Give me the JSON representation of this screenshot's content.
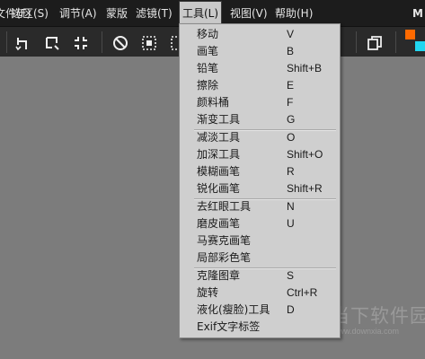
{
  "menubar": {
    "items": [
      "文件(F)",
      "选区(S)",
      "调节(A)",
      "蒙版",
      "滤镜(T)",
      "工具(L)",
      "视图(V)",
      "帮助(H)"
    ],
    "right_label": "M"
  },
  "tools_menu": {
    "items": [
      {
        "label": "移动",
        "key": "V"
      },
      {
        "label": "画笔",
        "key": "B"
      },
      {
        "label": "铅笔",
        "key": "Shift+B"
      },
      {
        "label": "擦除",
        "key": "E"
      },
      {
        "label": "颜料桶",
        "key": "F"
      },
      {
        "label": "渐变工具",
        "key": "G"
      },
      {
        "label": "减淡工具",
        "key": "O"
      },
      {
        "label": "加深工具",
        "key": "Shift+O"
      },
      {
        "label": "模糊画笔",
        "key": "R"
      },
      {
        "label": "锐化画笔",
        "key": "Shift+R"
      },
      {
        "label": "去红眼工具",
        "key": "N"
      },
      {
        "label": "磨皮画笔",
        "key": "U"
      },
      {
        "label": "马赛克画笔",
        "key": ""
      },
      {
        "label": "局部彩色笔",
        "key": ""
      },
      {
        "label": "克隆图章",
        "key": "S"
      },
      {
        "label": "旋转",
        "key": "Ctrl+R"
      },
      {
        "label": "液化(瘦脸)工具",
        "key": "D"
      },
      {
        "label": "Exif文字标签",
        "key": ""
      }
    ]
  },
  "colors": {
    "primary_swatch": "#ff6a00",
    "secondary_swatch": "#21d6f0"
  },
  "watermark": {
    "text": "当下软件园",
    "url": "www.downxia.com"
  },
  "icons": [
    "rotate-left-icon",
    "rotate-right-icon",
    "shrink-icon",
    "no-icon",
    "select-all-icon",
    "marquee-icon",
    "copy-icon"
  ]
}
